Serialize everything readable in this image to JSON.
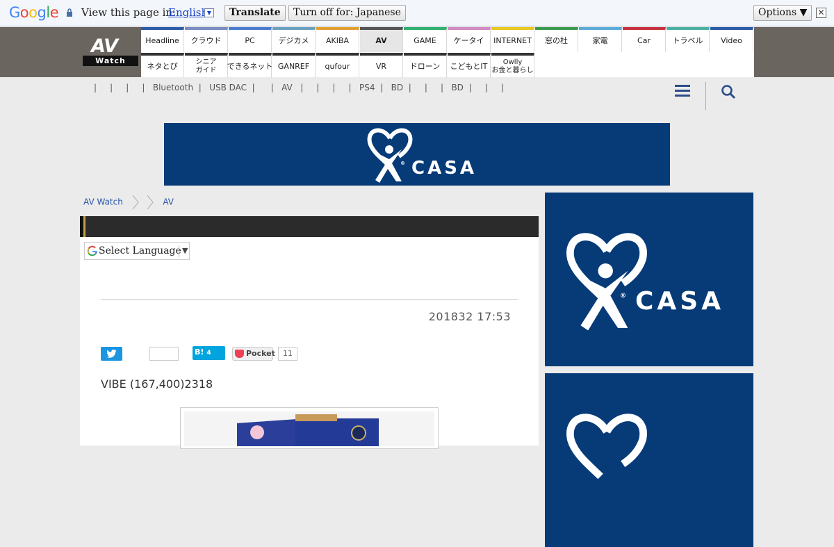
{
  "translate_bar": {
    "brand": "Google",
    "brand_colors": [
      "#4285f4",
      "#ea4335",
      "#fbbc05",
      "#4285f4",
      "#34a853",
      "#ea4335"
    ],
    "prompt": "View this page in:",
    "language": "English",
    "translate_button": "Translate",
    "turn_off_button": "Turn off for: Japanese",
    "options_button": "Options ▼",
    "close": "✕"
  },
  "site": {
    "logo_top": "AV",
    "logo_bottom": "Watch"
  },
  "nav": {
    "row1": [
      {
        "label": "Headline",
        "color": "#2a5caa"
      },
      {
        "label": "クラウド",
        "color": "#7a8cc0"
      },
      {
        "label": "PC",
        "color": "#4a7bd0"
      },
      {
        "label": "デジカメ",
        "color": "#6aa0c0"
      },
      {
        "label": "AKIBA",
        "color": "#e0a030"
      },
      {
        "label": "AV",
        "color": "#555555",
        "active": true
      },
      {
        "label": "GAME",
        "color": "#2fb070"
      },
      {
        "label": "ケータイ",
        "color": "#d08ac0"
      },
      {
        "label": "INTERNET",
        "color": "#e8c820"
      },
      {
        "label": "窓の杜",
        "color": "#3a9a50"
      },
      {
        "label": "家電",
        "color": "#5aaad8"
      },
      {
        "label": "Car",
        "color": "#c83040"
      },
      {
        "label": "トラベル",
        "color": "#4ab0a0"
      },
      {
        "label": "Video",
        "color": "#2a5caa"
      }
    ],
    "row2": [
      {
        "label": "ネタとぴ",
        "color": "#333333"
      },
      {
        "label": "シニア\nガイド",
        "color": "#333333"
      },
      {
        "label": "できるネット",
        "color": "#333333"
      },
      {
        "label": "GANREF",
        "color": "#333333"
      },
      {
        "label": "qufour",
        "color": "#333333"
      },
      {
        "label": "VR",
        "color": "#333333"
      },
      {
        "label": "ドローン",
        "color": "#333333"
      },
      {
        "label": "こどもとIT",
        "color": "#333333"
      },
      {
        "label": "Owlly\nお金と暮らし",
        "color": "#333333"
      }
    ]
  },
  "subnav": {
    "text": "|     |     |     |   Bluetooth  |   USB DAC  |      |   AV   |     |     |     |   PS4  |   BD  |     |     |   BD  |     |     |"
  },
  "ads": {
    "banner_word": "CASA",
    "side_word": "CASA",
    "registered": "®"
  },
  "breadcrumb": [
    "AV Watch",
    "AV"
  ],
  "article": {
    "language_select": "Select Language",
    "date": "201832 17:53",
    "hatena_count": "4",
    "pocket_label": "Pocket",
    "pocket_count": "11",
    "lead": "VIBE (167,400)2318"
  }
}
